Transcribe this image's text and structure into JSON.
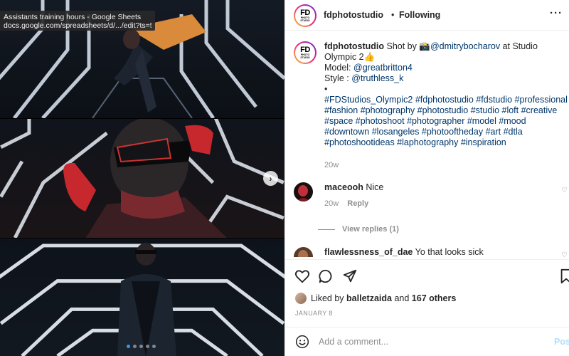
{
  "browser_tooltip": {
    "title": "Assistants training hours - Google Sheets",
    "url": "docs.google.com/spreadsheets/d/.../edit?ts=5..."
  },
  "carousel": {
    "next_icon": "chevron-right-icon",
    "slide_count": 5,
    "active_index": 0
  },
  "header": {
    "username": "fdphotostudio",
    "separator": "•",
    "follow_status": "Following",
    "more_icon": "more-horizontal-icon",
    "avatar_text": "FD",
    "avatar_subtext": "PHOTO STUDIO"
  },
  "caption": {
    "username": "fdphotostudio",
    "shot_by": "Shot by",
    "camera_emoji": "📸",
    "photographer": "@dmitrybocharov",
    "location_text": "at Studio Olympic 2",
    "thumbs_emoji": "👍",
    "model_label": "Model:",
    "model": "@greatbritton4",
    "style_label": "Style :",
    "stylist": "@truthless_k",
    "bullet": "•",
    "hashtags": "#FDStudios_Olympic2 #fdphotostudio #fdstudio #professional #fashion #photography #photostudio #studio #loft #creative #space #photoshoot #photographer #model #mood #downtown #losangeles #photooftheday #art #dtla #photoshootideas #laphotography #inspiration",
    "time": "20w"
  },
  "comments": [
    {
      "username": "maceooh",
      "text": "Nice",
      "time": "20w",
      "reply_label": "Reply"
    },
    {
      "username": "flawlessness_of_dae",
      "text": "Yo that looks sick"
    }
  ],
  "view_replies": "View replies (1)",
  "actions": {
    "like_icon": "heart-icon",
    "comment_icon": "comment-icon",
    "share_icon": "share-icon",
    "save_icon": "bookmark-icon"
  },
  "likes": {
    "prefix": "Liked by",
    "user": "balletzaida",
    "and": "and",
    "others": "167 others"
  },
  "date": "JANUARY 8",
  "add_comment": {
    "emoji_icon": "emoji-icon",
    "placeholder": "Add a comment...",
    "post_label": "Post"
  }
}
